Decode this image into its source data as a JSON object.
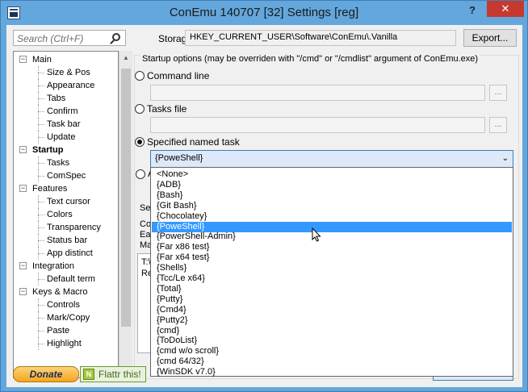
{
  "window": {
    "title": "ConEmu 140707 [32] Settings [reg]",
    "help_label": "?",
    "close_label": "✕"
  },
  "search": {
    "placeholder": "Search (Ctrl+F)"
  },
  "tree": {
    "items": [
      {
        "label": "Main",
        "level": 0,
        "expander": "−"
      },
      {
        "label": "Size & Pos",
        "level": 1
      },
      {
        "label": "Appearance",
        "level": 1
      },
      {
        "label": "Tabs",
        "level": 1
      },
      {
        "label": "Confirm",
        "level": 1
      },
      {
        "label": "Task bar",
        "level": 1
      },
      {
        "label": "Update",
        "level": 1
      },
      {
        "label": "Startup",
        "level": 0,
        "expander": "−",
        "selected": true
      },
      {
        "label": "Tasks",
        "level": 1
      },
      {
        "label": "ComSpec",
        "level": 1
      },
      {
        "label": "Features",
        "level": 0,
        "expander": "−"
      },
      {
        "label": "Text cursor",
        "level": 1
      },
      {
        "label": "Colors",
        "level": 1
      },
      {
        "label": "Transparency",
        "level": 1
      },
      {
        "label": "Status bar",
        "level": 1
      },
      {
        "label": "App distinct",
        "level": 1
      },
      {
        "label": "Integration",
        "level": 0,
        "expander": "−"
      },
      {
        "label": "Default term",
        "level": 1
      },
      {
        "label": "Keys & Macro",
        "level": 0,
        "expander": "−"
      },
      {
        "label": "Controls",
        "level": 1
      },
      {
        "label": "Mark/Copy",
        "level": 1
      },
      {
        "label": "Paste",
        "level": 1
      },
      {
        "label": "Highlight",
        "level": 1
      }
    ]
  },
  "storage": {
    "label": "Storage:",
    "value": "HKEY_CURRENT_USER\\Software\\ConEmu\\.Vanilla",
    "export_label": "Export..."
  },
  "startup": {
    "group_caption": "Startup options (may be overriden with \"/cmd\" or \"/cmdlist\" argument of ConEmu.exe)",
    "command_line_label": "Command line",
    "tasks_file_label": "Tasks file",
    "named_task_label": "Specified named task",
    "browse_label": "...",
    "selected_task": "{PoweShell}",
    "partial_radio_label": "A",
    "select_label": "Sele",
    "line1": "Com",
    "line2": "Eac",
    "line3": "Mar",
    "text_line1": "T:\\",
    "text_line2": "Re"
  },
  "task_options": [
    "<None>",
    "{ADB}",
    "{Bash}",
    "{Git Bash}",
    "{Chocolatey}",
    "{PoweShell}",
    "{PowerShell-Admin}",
    "{Far x86 test}",
    "{Far x64 test}",
    "{Shells}",
    "{Tcc/Le x64}",
    "{Total}",
    "{Putty}",
    "{Cmd4}",
    "{Putty2}",
    "{cmd}",
    "{ToDoList}",
    "{cmd w/o scroll}",
    "{cmd 64/32}",
    "{WinSDK v7.0}"
  ],
  "highlighted_option_index": 5,
  "footer": {
    "donate_label": "Donate",
    "flattr_label": "Flattr this!"
  }
}
